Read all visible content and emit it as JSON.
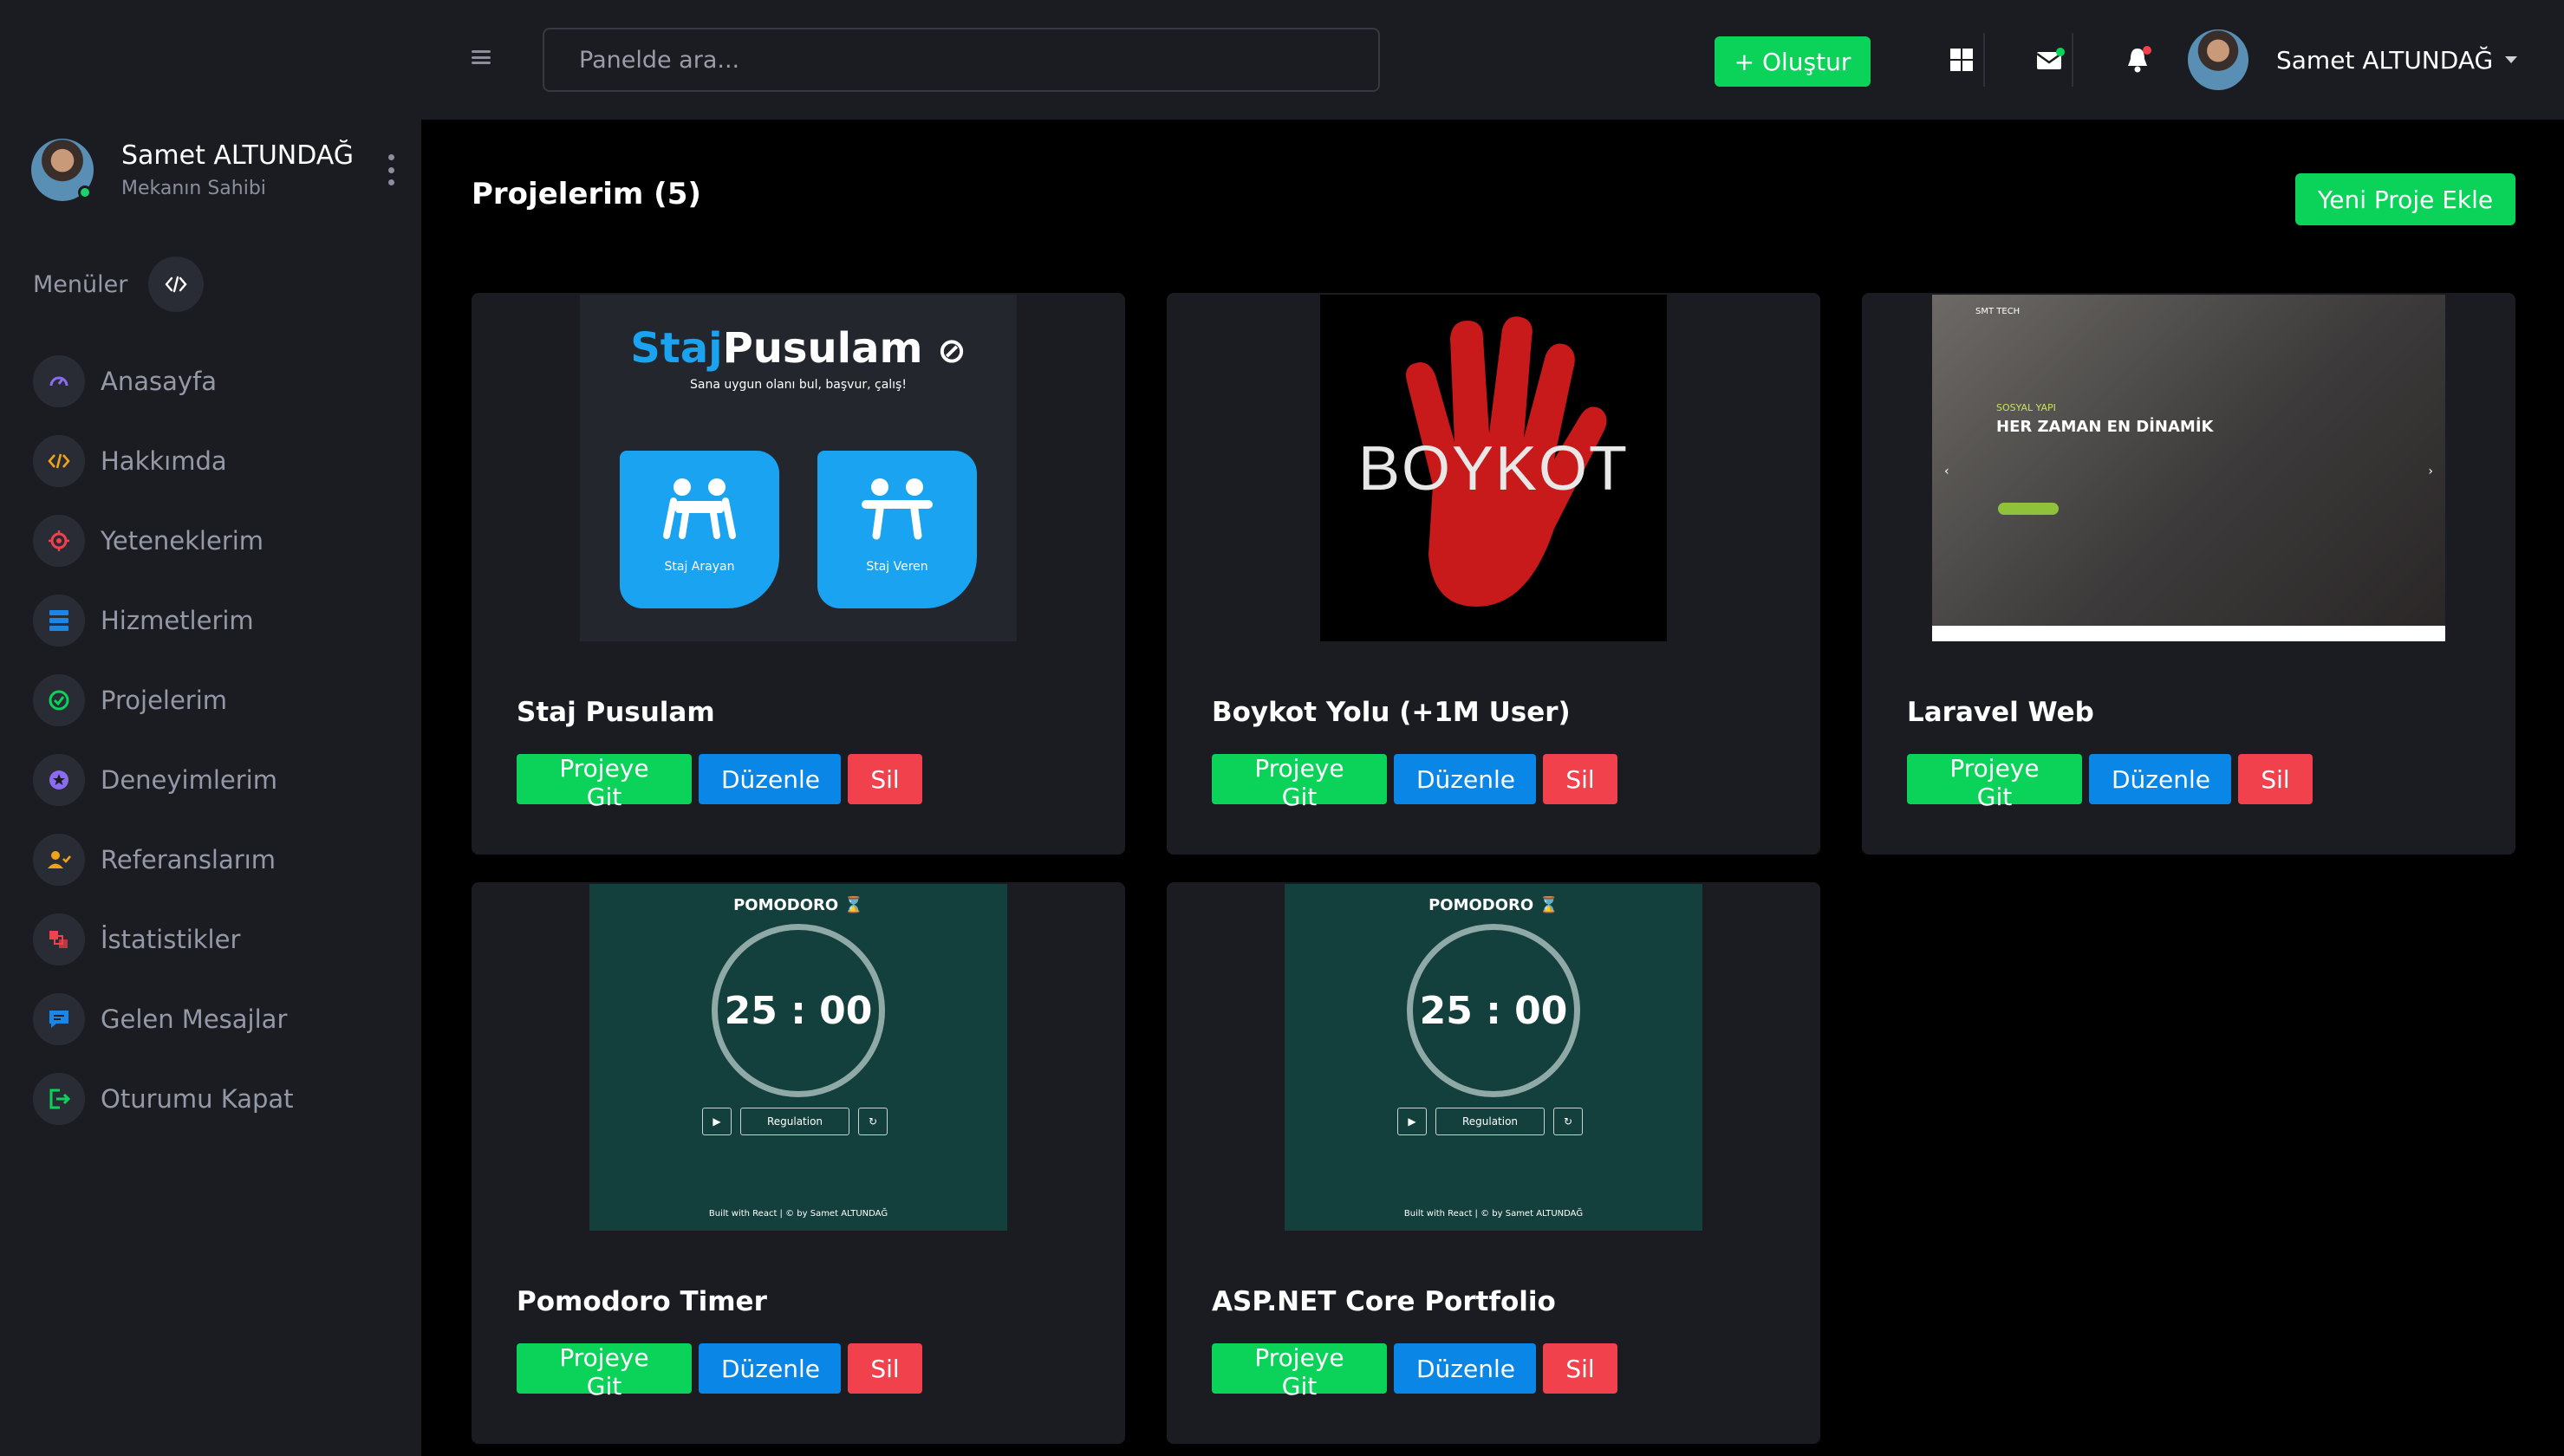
{
  "sidebar": {
    "user": {
      "name": "Samet ALTUNDAĞ",
      "role": "Mekanın Sahibi"
    },
    "menu_label": "Menüler",
    "items": [
      {
        "label": "Anasayfa",
        "icon": "dashboard-icon",
        "color": "#8b6cf0"
      },
      {
        "label": "Hakkımda",
        "icon": "code-icon",
        "color": "#f0a21a"
      },
      {
        "label": "Yeteneklerim",
        "icon": "target-icon",
        "color": "#f0414c"
      },
      {
        "label": "Hizmetlerim",
        "icon": "server-icon",
        "color": "#1a86e6"
      },
      {
        "label": "Projelerim",
        "icon": "check-circle-icon",
        "color": "#0bd35a"
      },
      {
        "label": "Deneyimlerim",
        "icon": "star-icon",
        "color": "#8b6cf0"
      },
      {
        "label": "Referanslarım",
        "icon": "user-check-icon",
        "color": "#f0a21a"
      },
      {
        "label": "İstatistikler",
        "icon": "chart-icon",
        "color": "#f0414c"
      },
      {
        "label": "Gelen Mesajlar",
        "icon": "message-icon",
        "color": "#1a86e6"
      },
      {
        "label": "Oturumu Kapat",
        "icon": "logout-icon",
        "color": "#0bd35a"
      }
    ]
  },
  "topbar": {
    "search_placeholder": "Panelde ara...",
    "create_label": "+ Oluştur",
    "user_name": "Samet ALTUNDAĞ"
  },
  "main": {
    "title": "Projelerim (5)",
    "new_button": "Yeni Proje Ekle",
    "buttons": {
      "go": "Projeye Git",
      "edit": "Düzenle",
      "delete": "Sil"
    },
    "projects": [
      {
        "title": "Staj Pusulam",
        "thumb": {
          "brand_a": "Staj",
          "brand_b": "Pusulam",
          "subtitle": "Sana uygun olanı bul, başvur, çalış!",
          "tile1": "Staj Arayan",
          "tile2": "Staj Veren"
        }
      },
      {
        "title": "Boykot Yolu (+1M User)",
        "thumb": {
          "word": "BOYKOT"
        }
      },
      {
        "title": "Laravel Web",
        "thumb": {
          "logo": "SMT TECH",
          "kicker": "SOSYAL YAPI",
          "headline": "HER ZAMAN EN DİNAMİK"
        }
      },
      {
        "title": "Pomodoro Timer",
        "thumb": {
          "title": "POMODORO ⌛",
          "time": "25 : 00",
          "mode": "Regulation",
          "footer": "Built with React | © by Samet ALTUNDAĞ"
        }
      },
      {
        "title": "ASP.NET Core Portfolio",
        "thumb": {
          "title": "POMODORO ⌛",
          "time": "25 : 00",
          "mode": "Regulation",
          "footer": "Built with React | © by Samet ALTUNDAĞ"
        }
      }
    ]
  },
  "colors": {
    "green": "#0bd35a",
    "blue": "#0a86e6",
    "red": "#f0414c",
    "panel": "#1b1c22"
  }
}
